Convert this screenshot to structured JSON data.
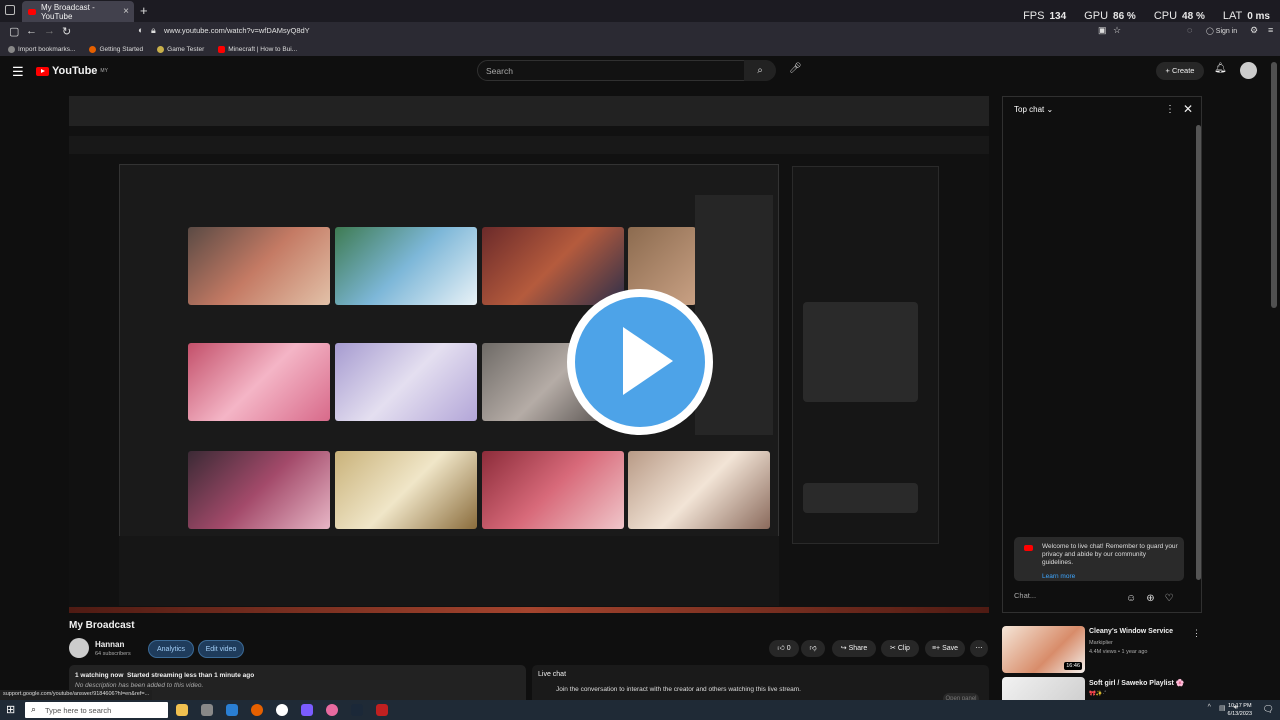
{
  "browser": {
    "tab_title": "My Broadcast - YouTube",
    "new_tab": "+",
    "url": "www.youtube.com/watch?v=wfDAMsyQ8dY",
    "bookmarks": [
      "Import bookmarks...",
      "Getting Started",
      "Game Tester",
      "Minecraft | How to Bui..."
    ],
    "perf": {
      "fps_label": "FPS",
      "fps": "134",
      "gpu_label": "GPU",
      "gpu": "86 %",
      "cpu_label": "CPU",
      "cpu": "48 %",
      "lat_label": "LAT",
      "lat": "0 ms"
    },
    "sign_in": "Sign in"
  },
  "youtube": {
    "logo": "YouTube",
    "logo_sup": "MY",
    "search_placeholder": "Search",
    "create_label": "+ Create"
  },
  "chat": {
    "title": "Top chat",
    "welcome": "Welcome to live chat! Remember to guard your privacy and abide by our community guidelines.",
    "learn_more": "Learn more",
    "input_placeholder": "Chat..."
  },
  "video": {
    "title": "My Broadcast",
    "channel": "Hannan",
    "subscribers": "64 subscribers",
    "analytics_label": "Analytics",
    "edit_label": "Edit video",
    "like_count": "0",
    "share_label": "Share",
    "clip_label": "Clip",
    "save_label": "Save",
    "desc_line1_bold": "1 watching now",
    "desc_line1": "Started streaming less than 1 minute ago",
    "desc_line2": "No description has been added to this video.",
    "livechat_title": "Live chat",
    "livechat_text": "Join the conversation to interact with the creator and others watching this live stream.",
    "open_panel": "Open panel"
  },
  "related": [
    {
      "title": "Cleany's Window Service",
      "channel": "Markiplier",
      "meta": "4.4M views • 1 year ago",
      "duration": "16:46"
    },
    {
      "title": "Soft girl / Saweko Playlist 🌸",
      "channel": "🎀✨·˚",
      "meta": "",
      "duration": ""
    }
  ],
  "status_url": "support.google.com/youtube/answer/9184606?hl=en&ref=...",
  "taskbar": {
    "search_placeholder": "Type here to search",
    "time": "10:17 PM",
    "date": "6/13/2023"
  }
}
